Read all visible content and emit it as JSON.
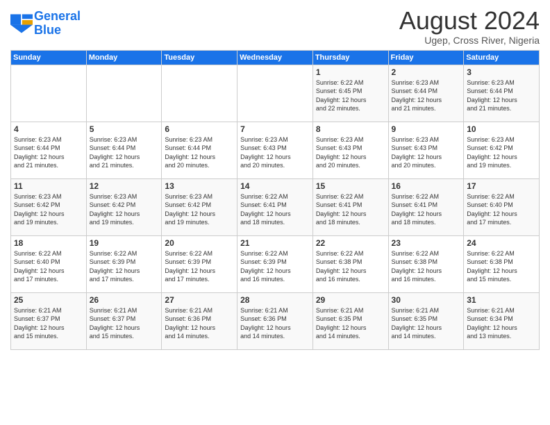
{
  "logo": {
    "line1": "General",
    "line2": "Blue"
  },
  "title": "August 2024",
  "subtitle": "Ugep, Cross River, Nigeria",
  "days_of_week": [
    "Sunday",
    "Monday",
    "Tuesday",
    "Wednesday",
    "Thursday",
    "Friday",
    "Saturday"
  ],
  "weeks": [
    [
      {
        "num": "",
        "text": ""
      },
      {
        "num": "",
        "text": ""
      },
      {
        "num": "",
        "text": ""
      },
      {
        "num": "",
        "text": ""
      },
      {
        "num": "1",
        "text": "Sunrise: 6:22 AM\nSunset: 6:45 PM\nDaylight: 12 hours\nand 22 minutes."
      },
      {
        "num": "2",
        "text": "Sunrise: 6:23 AM\nSunset: 6:44 PM\nDaylight: 12 hours\nand 21 minutes."
      },
      {
        "num": "3",
        "text": "Sunrise: 6:23 AM\nSunset: 6:44 PM\nDaylight: 12 hours\nand 21 minutes."
      }
    ],
    [
      {
        "num": "4",
        "text": "Sunrise: 6:23 AM\nSunset: 6:44 PM\nDaylight: 12 hours\nand 21 minutes."
      },
      {
        "num": "5",
        "text": "Sunrise: 6:23 AM\nSunset: 6:44 PM\nDaylight: 12 hours\nand 21 minutes."
      },
      {
        "num": "6",
        "text": "Sunrise: 6:23 AM\nSunset: 6:44 PM\nDaylight: 12 hours\nand 20 minutes."
      },
      {
        "num": "7",
        "text": "Sunrise: 6:23 AM\nSunset: 6:43 PM\nDaylight: 12 hours\nand 20 minutes."
      },
      {
        "num": "8",
        "text": "Sunrise: 6:23 AM\nSunset: 6:43 PM\nDaylight: 12 hours\nand 20 minutes."
      },
      {
        "num": "9",
        "text": "Sunrise: 6:23 AM\nSunset: 6:43 PM\nDaylight: 12 hours\nand 20 minutes."
      },
      {
        "num": "10",
        "text": "Sunrise: 6:23 AM\nSunset: 6:42 PM\nDaylight: 12 hours\nand 19 minutes."
      }
    ],
    [
      {
        "num": "11",
        "text": "Sunrise: 6:23 AM\nSunset: 6:42 PM\nDaylight: 12 hours\nand 19 minutes."
      },
      {
        "num": "12",
        "text": "Sunrise: 6:23 AM\nSunset: 6:42 PM\nDaylight: 12 hours\nand 19 minutes."
      },
      {
        "num": "13",
        "text": "Sunrise: 6:23 AM\nSunset: 6:42 PM\nDaylight: 12 hours\nand 19 minutes."
      },
      {
        "num": "14",
        "text": "Sunrise: 6:22 AM\nSunset: 6:41 PM\nDaylight: 12 hours\nand 18 minutes."
      },
      {
        "num": "15",
        "text": "Sunrise: 6:22 AM\nSunset: 6:41 PM\nDaylight: 12 hours\nand 18 minutes."
      },
      {
        "num": "16",
        "text": "Sunrise: 6:22 AM\nSunset: 6:41 PM\nDaylight: 12 hours\nand 18 minutes."
      },
      {
        "num": "17",
        "text": "Sunrise: 6:22 AM\nSunset: 6:40 PM\nDaylight: 12 hours\nand 17 minutes."
      }
    ],
    [
      {
        "num": "18",
        "text": "Sunrise: 6:22 AM\nSunset: 6:40 PM\nDaylight: 12 hours\nand 17 minutes."
      },
      {
        "num": "19",
        "text": "Sunrise: 6:22 AM\nSunset: 6:39 PM\nDaylight: 12 hours\nand 17 minutes."
      },
      {
        "num": "20",
        "text": "Sunrise: 6:22 AM\nSunset: 6:39 PM\nDaylight: 12 hours\nand 17 minutes."
      },
      {
        "num": "21",
        "text": "Sunrise: 6:22 AM\nSunset: 6:39 PM\nDaylight: 12 hours\nand 16 minutes."
      },
      {
        "num": "22",
        "text": "Sunrise: 6:22 AM\nSunset: 6:38 PM\nDaylight: 12 hours\nand 16 minutes."
      },
      {
        "num": "23",
        "text": "Sunrise: 6:22 AM\nSunset: 6:38 PM\nDaylight: 12 hours\nand 16 minutes."
      },
      {
        "num": "24",
        "text": "Sunrise: 6:22 AM\nSunset: 6:38 PM\nDaylight: 12 hours\nand 15 minutes."
      }
    ],
    [
      {
        "num": "25",
        "text": "Sunrise: 6:21 AM\nSunset: 6:37 PM\nDaylight: 12 hours\nand 15 minutes."
      },
      {
        "num": "26",
        "text": "Sunrise: 6:21 AM\nSunset: 6:37 PM\nDaylight: 12 hours\nand 15 minutes."
      },
      {
        "num": "27",
        "text": "Sunrise: 6:21 AM\nSunset: 6:36 PM\nDaylight: 12 hours\nand 14 minutes."
      },
      {
        "num": "28",
        "text": "Sunrise: 6:21 AM\nSunset: 6:36 PM\nDaylight: 12 hours\nand 14 minutes."
      },
      {
        "num": "29",
        "text": "Sunrise: 6:21 AM\nSunset: 6:35 PM\nDaylight: 12 hours\nand 14 minutes."
      },
      {
        "num": "30",
        "text": "Sunrise: 6:21 AM\nSunset: 6:35 PM\nDaylight: 12 hours\nand 14 minutes."
      },
      {
        "num": "31",
        "text": "Sunrise: 6:21 AM\nSunset: 6:34 PM\nDaylight: 12 hours\nand 13 minutes."
      }
    ]
  ]
}
